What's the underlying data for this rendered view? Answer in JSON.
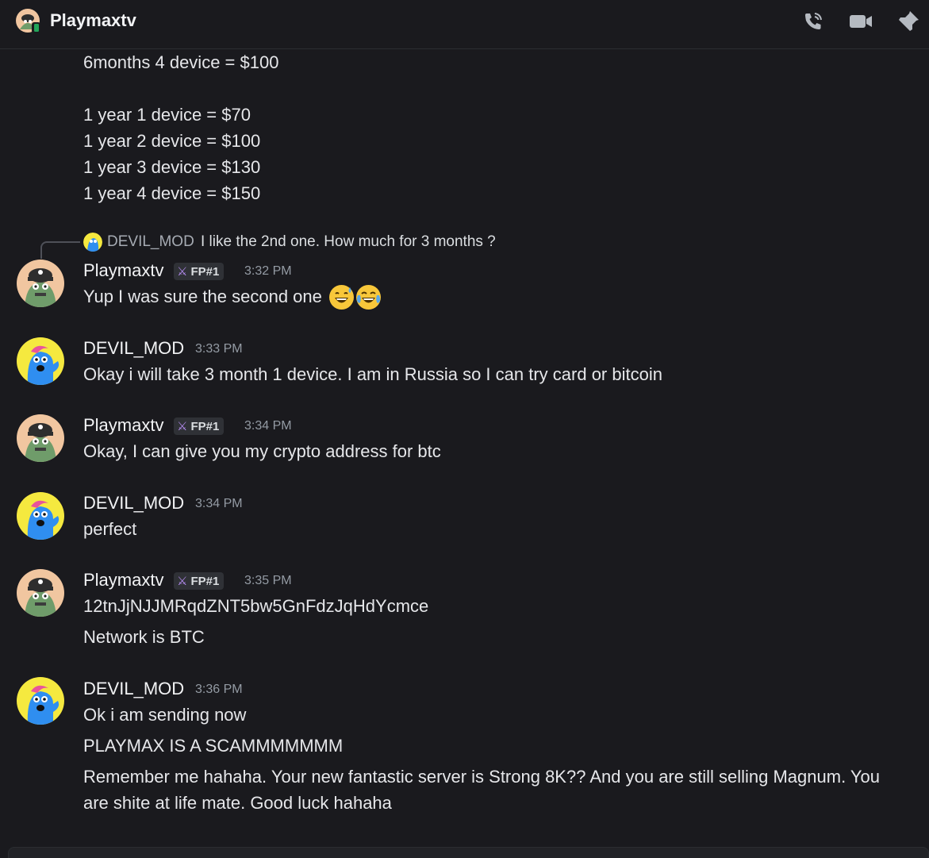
{
  "header": {
    "title": "Playmaxtv",
    "icons": [
      "phone-call-icon",
      "video-camera-icon",
      "pin-icon"
    ]
  },
  "pricing_continuation": [
    "6months 4 device = $100",
    "1 year 1 device = $70",
    "1 year 2 device = $100",
    "1 year 3 device = $130",
    "1 year 4 device = $150"
  ],
  "reply": {
    "name": "DEVIL_MOD",
    "text": "I like the 2nd one. How much for 3 months ?"
  },
  "messages": [
    {
      "author": "Playmaxtv",
      "badge": "FP#1",
      "time": "3:32 PM",
      "lines": [
        "Yup I was sure the second one"
      ]
    },
    {
      "author": "DEVIL_MOD",
      "time": "3:33 PM",
      "lines": [
        "Okay i will take 3 month 1 device. I am in Russia so I can try card or bitcoin"
      ]
    },
    {
      "author": "Playmaxtv",
      "badge": "FP#1",
      "time": "3:34 PM",
      "lines": [
        "Okay, I can give you my crypto address for btc"
      ]
    },
    {
      "author": "DEVIL_MOD",
      "time": "3:34 PM",
      "lines": [
        "perfect"
      ]
    },
    {
      "author": "Playmaxtv",
      "badge": "FP#1",
      "time": "3:35 PM",
      "lines": [
        "12tnJjNJJMRqdZNT5bw5GnFdzJqHdYcmce",
        "Network is BTC"
      ]
    },
    {
      "author": "DEVIL_MOD",
      "time": "3:36 PM",
      "lines": [
        "Ok i am sending now",
        "PLAYMAX IS A SCAMMMMMMM",
        "Remember me hahaha. Your new fantastic server is Strong 8K?? And you are still selling Magnum. You",
        "are shite at life mate. Good luck hahaha"
      ]
    }
  ],
  "colors": {
    "background": "#1a1a1e",
    "text": "#e6e7ea",
    "timestamp": "#949ba4",
    "devil_avatar_bg": "#f5e93f",
    "devil_avatar_figure": "#2f8ef0",
    "playmax_avatar_bg": "#f1c6a0",
    "playmax_avatar_figure": "#7aa57a"
  }
}
